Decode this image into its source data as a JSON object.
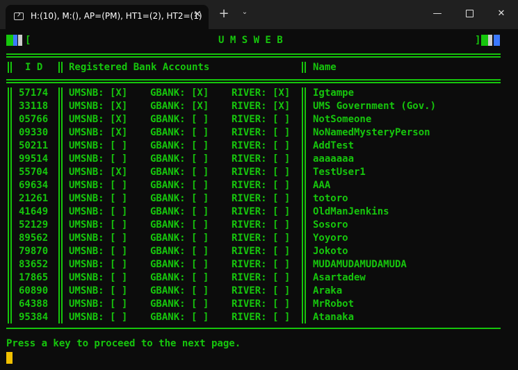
{
  "tab": {
    "title": "H:(10), M:(), AP=(PM), HT1=(2), HT2=(1)",
    "close_glyph": "✕"
  },
  "window_controls": {
    "minimize": "—",
    "close": "✕",
    "new_tab": "+",
    "dropdown": "⌄"
  },
  "banner": {
    "left_bracket": "[",
    "title": "U M S W E B",
    "right_bracket": "]"
  },
  "header": {
    "id": "I D",
    "accounts": "Registered Bank Accounts",
    "name": "Name"
  },
  "rows": [
    {
      "id": "57174",
      "umsnb": "UMSNB: [X]",
      "gbank": "GBANK: [X]",
      "river": "RIVER: [X]",
      "name": "Igtampe"
    },
    {
      "id": "33118",
      "umsnb": "UMSNB: [X]",
      "gbank": "GBANK: [X]",
      "river": "RIVER: [X]",
      "name": "UMS Government (Gov.)"
    },
    {
      "id": "05766",
      "umsnb": "UMSNB: [X]",
      "gbank": "GBANK: [ ]",
      "river": "RIVER: [ ]",
      "name": "NotSomeone"
    },
    {
      "id": "09330",
      "umsnb": "UMSNB: [X]",
      "gbank": "GBANK: [ ]",
      "river": "RIVER: [ ]",
      "name": "NoNamedMysteryPerson"
    },
    {
      "id": "50211",
      "umsnb": "UMSNB: [ ]",
      "gbank": "GBANK: [ ]",
      "river": "RIVER: [ ]",
      "name": "AddTest"
    },
    {
      "id": "99514",
      "umsnb": "UMSNB: [ ]",
      "gbank": "GBANK: [ ]",
      "river": "RIVER: [ ]",
      "name": "aaaaaaa"
    },
    {
      "id": "55704",
      "umsnb": "UMSNB: [X]",
      "gbank": "GBANK: [ ]",
      "river": "RIVER: [ ]",
      "name": "TestUser1"
    },
    {
      "id": "69634",
      "umsnb": "UMSNB: [ ]",
      "gbank": "GBANK: [ ]",
      "river": "RIVER: [ ]",
      "name": "AAA"
    },
    {
      "id": "21261",
      "umsnb": "UMSNB: [ ]",
      "gbank": "GBANK: [ ]",
      "river": "RIVER: [ ]",
      "name": "totoro"
    },
    {
      "id": "41649",
      "umsnb": "UMSNB: [ ]",
      "gbank": "GBANK: [ ]",
      "river": "RIVER: [ ]",
      "name": "OldManJenkins"
    },
    {
      "id": "52129",
      "umsnb": "UMSNB: [ ]",
      "gbank": "GBANK: [ ]",
      "river": "RIVER: [ ]",
      "name": "Sosoro"
    },
    {
      "id": "89562",
      "umsnb": "UMSNB: [ ]",
      "gbank": "GBANK: [ ]",
      "river": "RIVER: [ ]",
      "name": "Yoyoro"
    },
    {
      "id": "79870",
      "umsnb": "UMSNB: [ ]",
      "gbank": "GBANK: [ ]",
      "river": "RIVER: [ ]",
      "name": "Jokoto"
    },
    {
      "id": "83652",
      "umsnb": "UMSNB: [ ]",
      "gbank": "GBANK: [ ]",
      "river": "RIVER: [ ]",
      "name": "MUDAMUDAMUDAMUDA"
    },
    {
      "id": "17865",
      "umsnb": "UMSNB: [ ]",
      "gbank": "GBANK: [ ]",
      "river": "RIVER: [ ]",
      "name": "Asartadew"
    },
    {
      "id": "60890",
      "umsnb": "UMSNB: [ ]",
      "gbank": "GBANK: [ ]",
      "river": "RIVER: [ ]",
      "name": "Araka"
    },
    {
      "id": "64388",
      "umsnb": "UMSNB: [ ]",
      "gbank": "GBANK: [ ]",
      "river": "RIVER: [ ]",
      "name": "MrRobot"
    },
    {
      "id": "95384",
      "umsnb": "UMSNB: [ ]",
      "gbank": "GBANK: [ ]",
      "river": "RIVER: [ ]",
      "name": "Atanaka"
    }
  ],
  "footer": {
    "prompt": "Press a key to proceed to the next page."
  },
  "colors": {
    "terminal_green": "#16c60c",
    "background": "#0c0c0c",
    "accent_blue": "#3b78ff",
    "cursor": "#f0c000"
  }
}
